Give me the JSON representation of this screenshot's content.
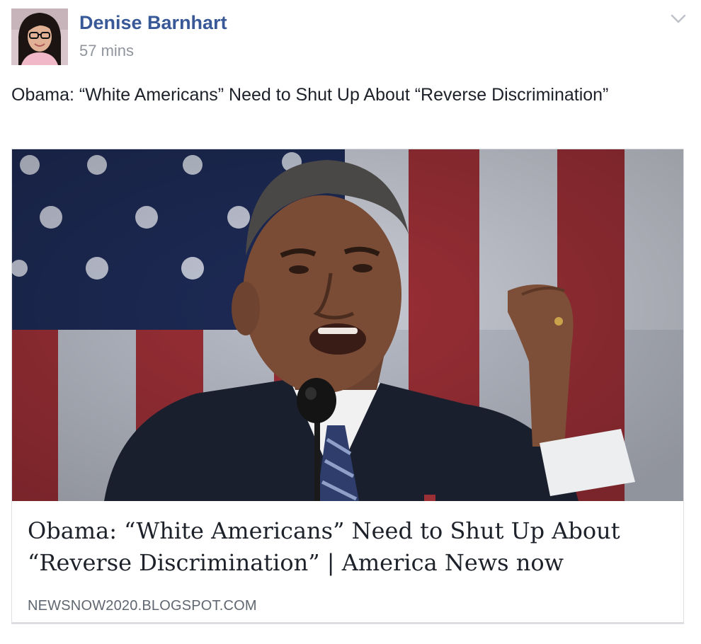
{
  "post": {
    "author": "Denise Barnhart",
    "timestamp": "57 mins",
    "text": "Obama: “White Americans” Need to Shut Up About “Reverse Discrimination”",
    "menu_icon": "chevron-down-icon",
    "avatar_icon": "profile-photo",
    "link_card": {
      "image_icon": "speaker-at-podium-photo",
      "title": "Obama: “White Americans” Need to Shut Up About “Reverse Discrimination” | America News now",
      "domain": "NEWSNOW2020.BLOGSPOT.COM"
    }
  },
  "colors": {
    "author_link": "#385898",
    "meta_gray": "#90949c",
    "body_text": "#1d2129",
    "card_border": "#dddfe2",
    "domain_text": "#606770"
  }
}
